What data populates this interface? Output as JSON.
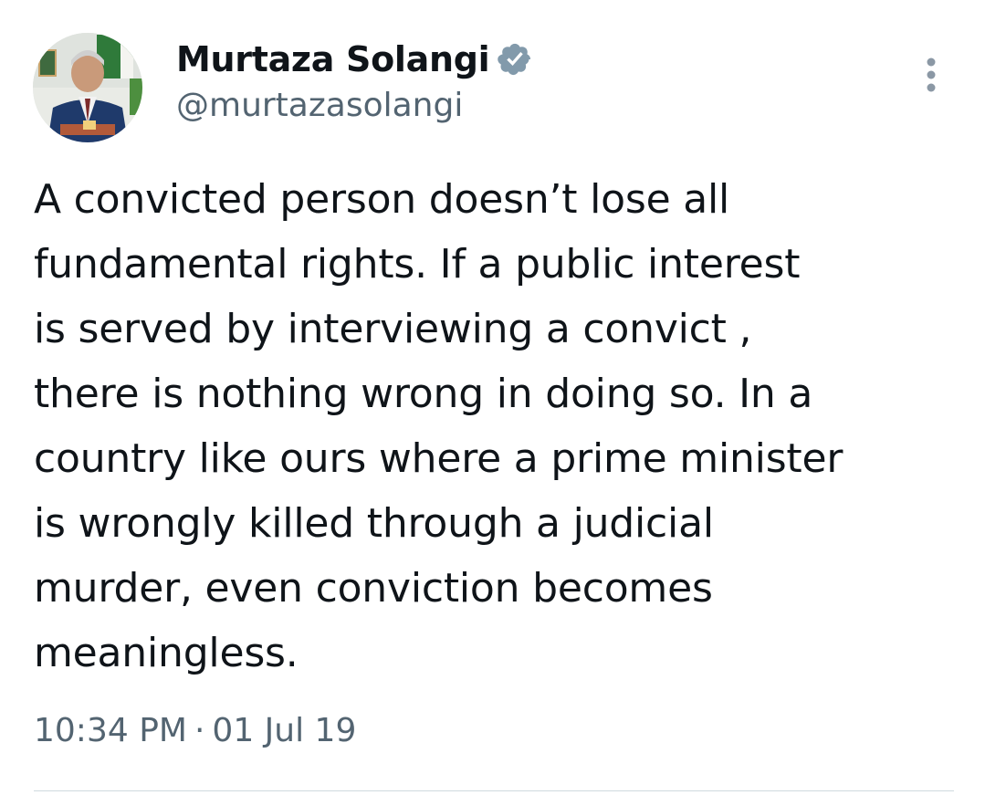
{
  "tweet": {
    "author": {
      "display_name": "Murtaza Solangi",
      "handle": "@murtazasolangi",
      "verified": true,
      "avatar_icon": "profile-photo",
      "badge_color": "#829aab"
    },
    "more_icon": "more-options-icon",
    "text": "A convicted person doesn’t lose all\nfundamental rights. If a public interest\nis served by interviewing a convict ,\nthere is nothing wrong in doing so. In a\ncountry like ours where a prime minister\nis wrongly killed through a judicial\nmurder, even conviction becomes\nmeaningless.",
    "time": "10:34 PM",
    "separator": "·",
    "date": "01 Jul 19"
  },
  "colors": {
    "text_primary": "#0f1419",
    "text_secondary": "#536471",
    "divider": "#cfd9de"
  }
}
